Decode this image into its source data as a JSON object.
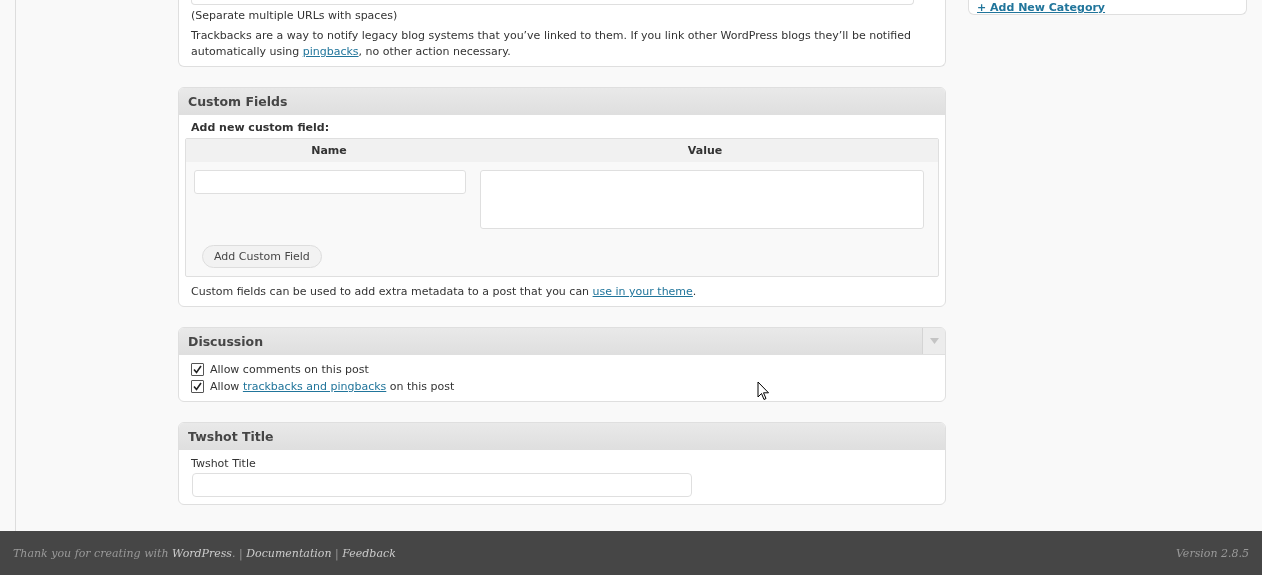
{
  "sidebar": {
    "add_category_link": "+ Add New Category"
  },
  "trackbacks": {
    "hint": "(Separate multiple URLs with spaces)",
    "description": [
      {
        "kind": "text",
        "text": "Trackbacks are a way to notify legacy blog systems that you’ve linked to them. If you link other WordPress blogs they’ll be notified automatically using "
      },
      {
        "kind": "link",
        "text": "pingbacks"
      },
      {
        "kind": "text",
        "text": ", no other action necessary."
      }
    ]
  },
  "custom_fields": {
    "title": "Custom Fields",
    "subtitle": "Add new custom field:",
    "columns": [
      "Name",
      "Value"
    ],
    "button": "Add Custom Field",
    "note": [
      {
        "kind": "text",
        "text": "Custom fields can be used to add extra metadata to a post that you can "
      },
      {
        "kind": "link",
        "text": "use in your theme"
      },
      {
        "kind": "text",
        "text": "."
      }
    ]
  },
  "discussion": {
    "title": "Discussion",
    "options": [
      {
        "checked": true,
        "label": [
          {
            "kind": "text",
            "text": "Allow comments on this post"
          }
        ]
      },
      {
        "checked": true,
        "label": [
          {
            "kind": "text",
            "text": "Allow "
          },
          {
            "kind": "link",
            "text": "trackbacks and pingbacks"
          },
          {
            "kind": "text",
            "text": " on this post"
          }
        ]
      }
    ]
  },
  "twshot": {
    "title": "Twshot Title",
    "field_label": "Twshot Title"
  },
  "footer": {
    "credits": [
      {
        "kind": "text",
        "text": "Thank you for creating with "
      },
      {
        "kind": "link",
        "text": "WordPress"
      },
      {
        "kind": "text",
        "text": ". | "
      },
      {
        "kind": "link",
        "text": "Documentation"
      },
      {
        "kind": "text",
        "text": " | "
      },
      {
        "kind": "link",
        "text": "Feedback"
      }
    ],
    "version": "Version 2.8.5"
  }
}
